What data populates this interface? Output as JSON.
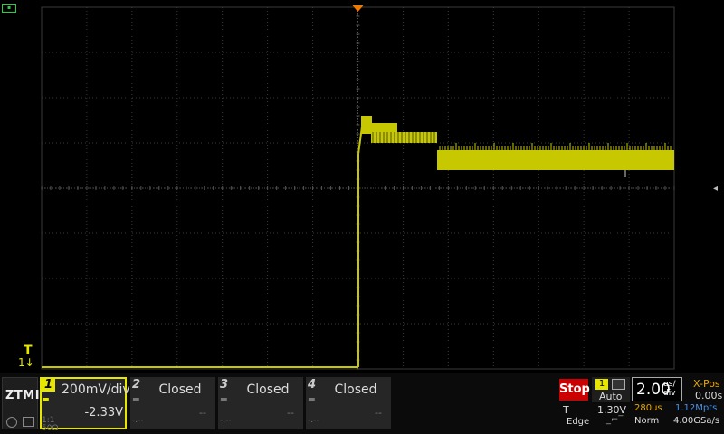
{
  "display": {
    "grid_color": "#3a3a3a",
    "trace_color": "#c8c800",
    "trigger_marker_color": "#f07800",
    "trigger_marker_glyph": "T",
    "ch1_ground_marker": "1↓",
    "right_scroll_glyph": "◂"
  },
  "status_icon": "battery-icon",
  "logo": {
    "text": "ZTMI"
  },
  "channels": [
    {
      "num": "1",
      "scale": "200mV/div",
      "offset": "-2.33V",
      "coupling_top": "1:1",
      "coupling_bottom": "50Ω",
      "color": "#e6e600",
      "active": true
    },
    {
      "num": "2",
      "scale": "Closed",
      "offset": "--",
      "color": "#cccccc",
      "active": false
    },
    {
      "num": "3",
      "scale": "Closed",
      "offset": "--",
      "color": "#cccccc",
      "active": false
    },
    {
      "num": "4",
      "scale": "Closed",
      "offset": "--",
      "color": "#cccccc",
      "active": false
    }
  ],
  "run_state": "Stop",
  "trigger": {
    "source": "1",
    "mode": "Auto",
    "label": "T",
    "level": "1.30V",
    "type": "Edge",
    "slope_icon": "rising-edge-icon"
  },
  "timebase": {
    "value": "2.00",
    "unit_top": "us/",
    "unit_bottom": "div"
  },
  "xpos": {
    "label": "X-Pos",
    "value": "0.00s"
  },
  "memory": {
    "time": "280us",
    "depth": "1.12Mpts"
  },
  "acquire": {
    "mode": "Norm",
    "rate": "4.00GSa/s"
  }
}
